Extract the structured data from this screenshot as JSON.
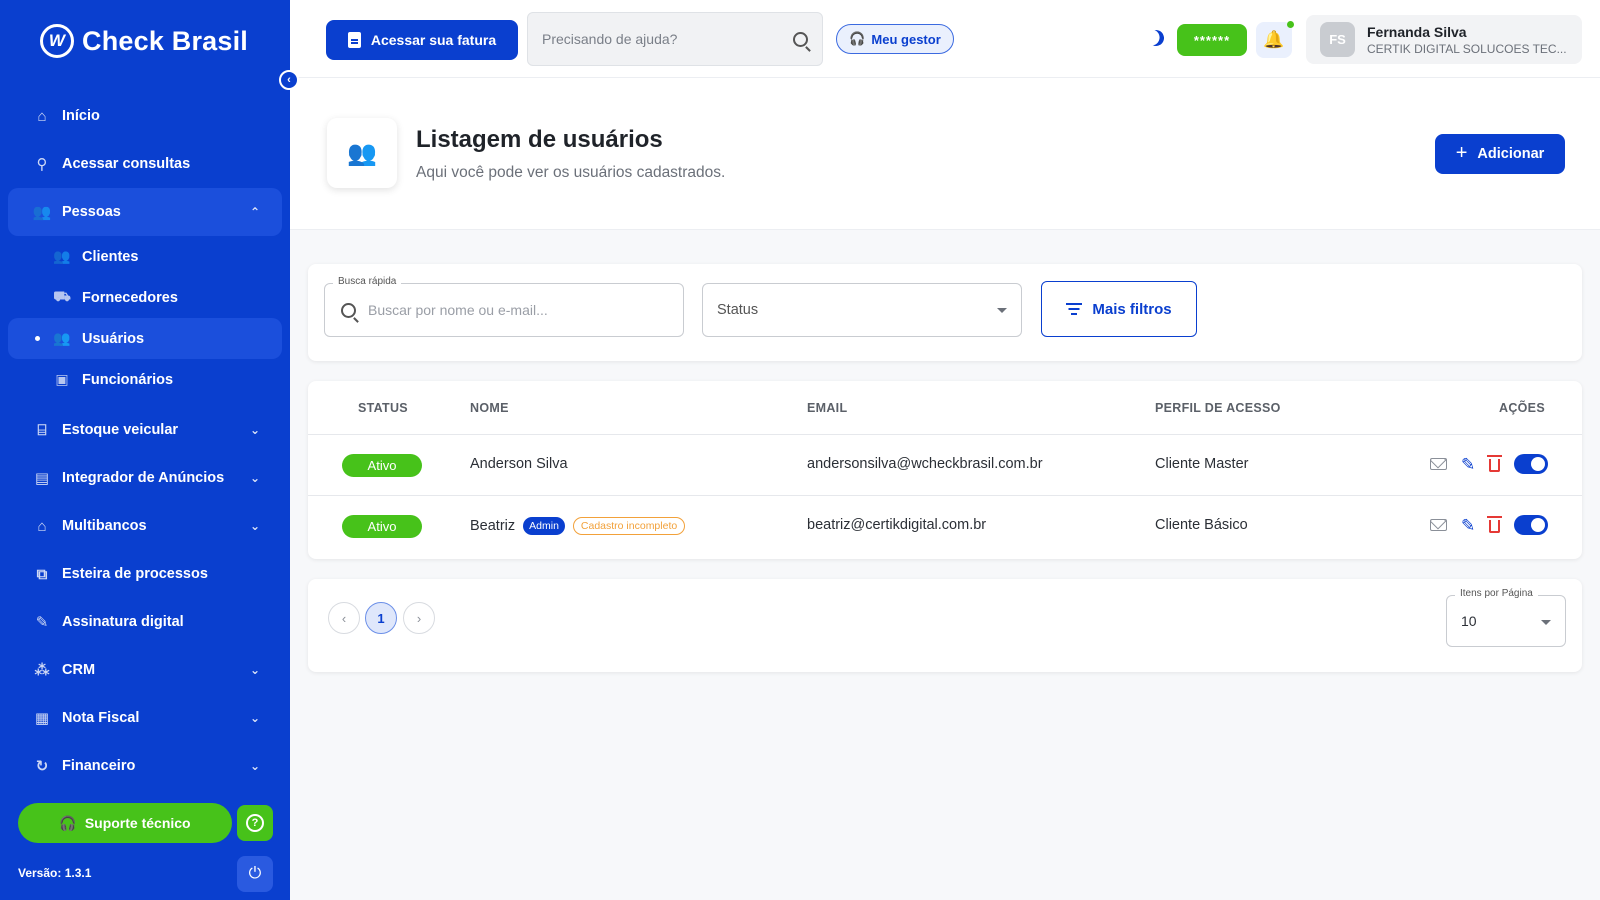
{
  "brand": {
    "name": "Check Brasil",
    "logo_letter": "W"
  },
  "sidebar": {
    "items": [
      {
        "label": "Início",
        "icon": "home-icon"
      },
      {
        "label": "Acessar consultas",
        "icon": "search-icon"
      },
      {
        "label": "Pessoas",
        "icon": "people-icon",
        "expanded": true
      },
      {
        "label": "Estoque veicular",
        "icon": "garage-icon"
      },
      {
        "label": "Integrador de Anúncios",
        "icon": "ads-icon"
      },
      {
        "label": "Multibancos",
        "icon": "bank-icon"
      },
      {
        "label": "Esteira de processos",
        "icon": "process-icon"
      },
      {
        "label": "Assinatura digital",
        "icon": "signature-icon"
      },
      {
        "label": "CRM",
        "icon": "crm-icon"
      },
      {
        "label": "Nota Fiscal",
        "icon": "invoice-icon"
      },
      {
        "label": "Financeiro",
        "icon": "finance-icon"
      }
    ],
    "sub_items": [
      {
        "label": "Clientes",
        "icon": "clients-icon"
      },
      {
        "label": "Fornecedores",
        "icon": "truck-icon"
      },
      {
        "label": "Usuários",
        "icon": "users-icon",
        "active": true
      },
      {
        "label": "Funcionários",
        "icon": "badge-icon"
      }
    ],
    "support_label": "Suporte técnico",
    "version": "Versão: 1.3.1"
  },
  "topbar": {
    "invoice_label": "Acessar sua fatura",
    "help_placeholder": "Precisando de ajuda?",
    "manager_label": "Meu gestor",
    "password_mask": "******",
    "user": {
      "initials": "FS",
      "name": "Fernanda Silva",
      "company": "CERTIK DIGITAL SOLUCOES TEC..."
    }
  },
  "header": {
    "title": "Listagem de usuários",
    "subtitle": "Aqui você pode ver os usuários cadastrados.",
    "add_label": "Adicionar"
  },
  "filters": {
    "quick_label": "Busca rápida",
    "quick_placeholder": "Buscar por nome ou e-mail...",
    "status_placeholder": "Status",
    "more_label": "Mais filtros"
  },
  "table": {
    "columns": {
      "status": "STATUS",
      "name": "NOME",
      "email": "EMAIL",
      "profile": "PERFIL DE ACESSO",
      "actions": "AÇÕES"
    },
    "rows": [
      {
        "status": "Ativo",
        "name": "Anderson Silva",
        "badges": [],
        "email": "andersonsilva@wcheckbrasil.com.br",
        "profile": "Cliente Master",
        "enabled": true
      },
      {
        "status": "Ativo",
        "name": "Beatriz",
        "badge_admin": "Admin",
        "badge_incomplete": "Cadastro incompleto",
        "email": "beatriz@certikdigital.com.br",
        "profile": "Cliente Básico",
        "enabled": true
      }
    ]
  },
  "pagination": {
    "current_page": "1",
    "per_page_label": "Itens por Página",
    "per_page_value": "10"
  },
  "colors": {
    "primary": "#0a3fcf",
    "success": "#47c21a",
    "danger": "#e53935",
    "warning": "#f2a13a"
  }
}
